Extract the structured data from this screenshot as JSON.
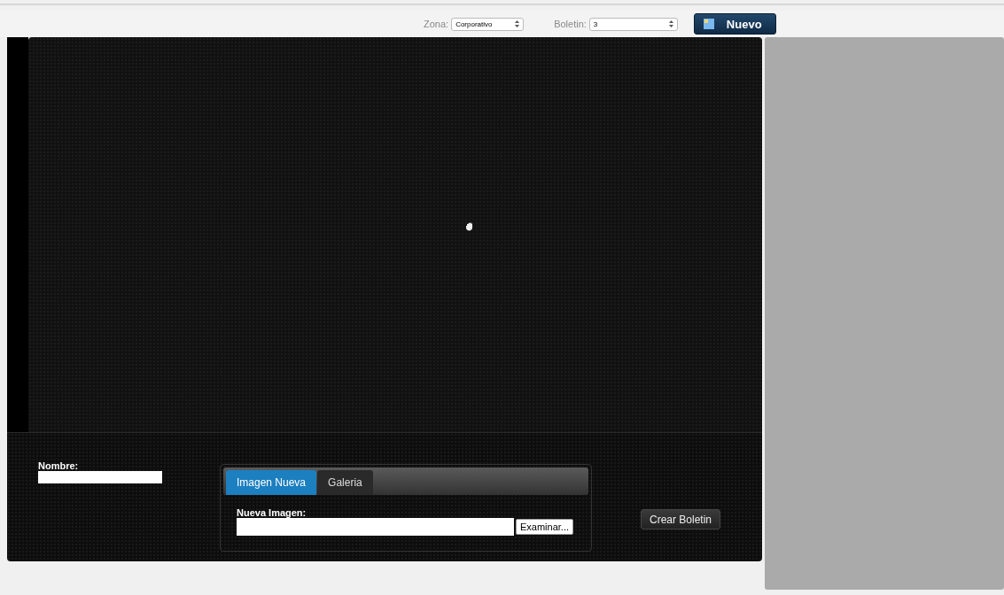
{
  "toolbar": {
    "zona": {
      "label": "Zona:",
      "value": "Corporativo"
    },
    "boletin": {
      "label": "Boletin:",
      "value": "3"
    },
    "new_button": "Nuevo"
  },
  "form": {
    "nombre": {
      "label": "Nombre:"
    },
    "tabs": [
      {
        "label": "Imagen Nueva",
        "selected": true
      },
      {
        "label": "Galeria",
        "selected": false
      }
    ],
    "image": {
      "label": "Nueva Imagen:",
      "browse_button": "Examinar..."
    },
    "create_button": "Crear Boletin"
  }
}
